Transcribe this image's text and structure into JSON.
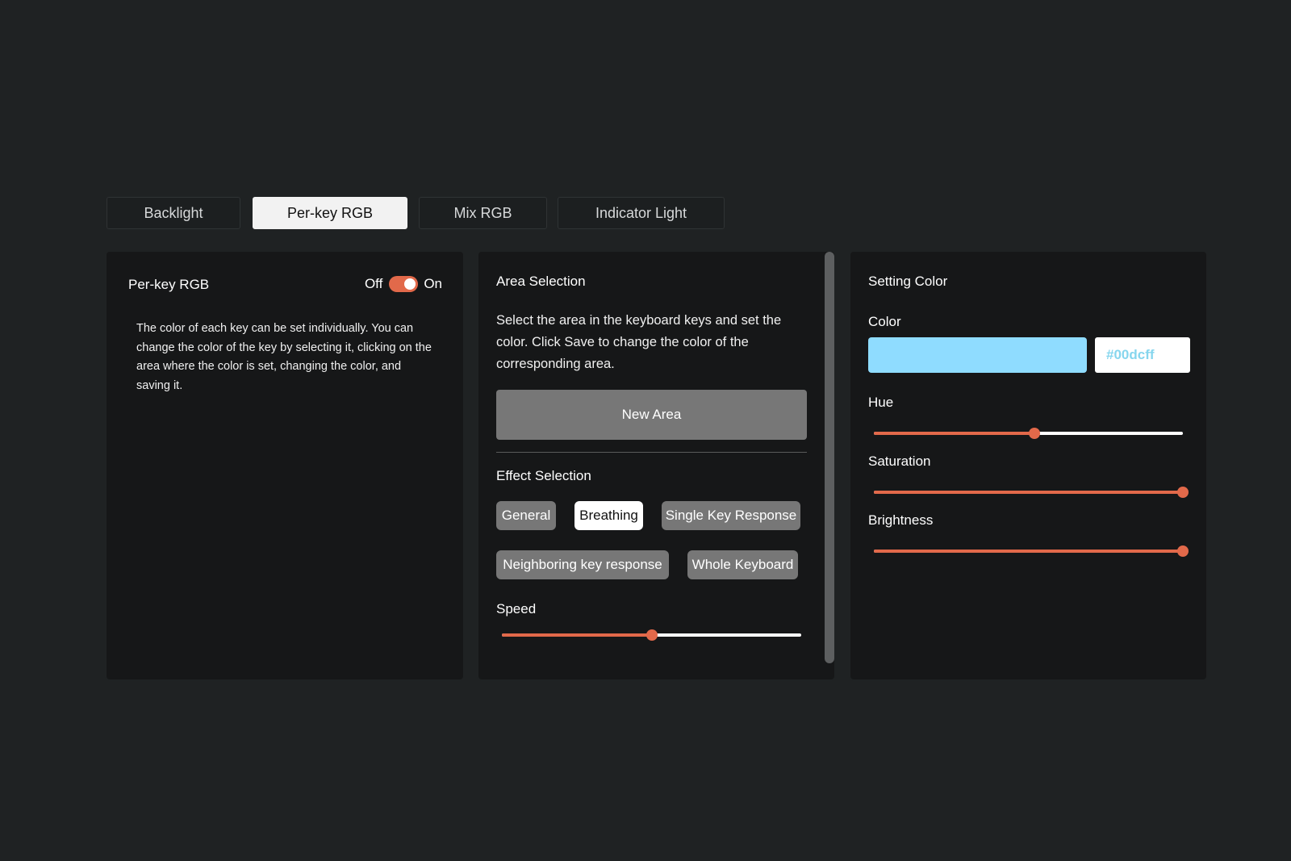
{
  "tabs": [
    {
      "label": "Backlight",
      "active": false
    },
    {
      "label": "Per-key RGB",
      "active": true
    },
    {
      "label": "Mix RGB",
      "active": false
    },
    {
      "label": "Indicator Light",
      "active": false
    }
  ],
  "perkey_panel": {
    "title": "Per-key RGB",
    "toggle_off_label": "Off",
    "toggle_on_label": "On",
    "toggle_state": "on",
    "description": "The color of each key can be set individually. You can change the color of the key by selecting it, clicking on the area where the color is set, changing the color, and saving it."
  },
  "area_panel": {
    "title": "Area Selection",
    "description": "Select the area in the keyboard keys and set the color. Click Save to change the color of the corresponding area.",
    "new_area_label": "New Area",
    "effect_title": "Effect Selection",
    "effects": [
      {
        "label": "General",
        "active": false
      },
      {
        "label": "Breathing",
        "active": true
      },
      {
        "label": "Single Key Response",
        "active": false
      },
      {
        "label": "Neighboring key response",
        "active": false
      },
      {
        "label": "Whole Keyboard",
        "active": false
      }
    ],
    "speed_label": "Speed",
    "speed_value": 0.5
  },
  "color_panel": {
    "title": "Setting Color",
    "color_label": "Color",
    "swatch_color": "#8fdcff",
    "hex_value": "#00dcff",
    "hue_label": "Hue",
    "hue_value": 0.52,
    "saturation_label": "Saturation",
    "saturation_value": 1.0,
    "brightness_label": "Brightness",
    "brightness_value": 1.0
  },
  "colors": {
    "accent": "#e2694a",
    "background": "#1f2223",
    "panel": "#161718"
  }
}
